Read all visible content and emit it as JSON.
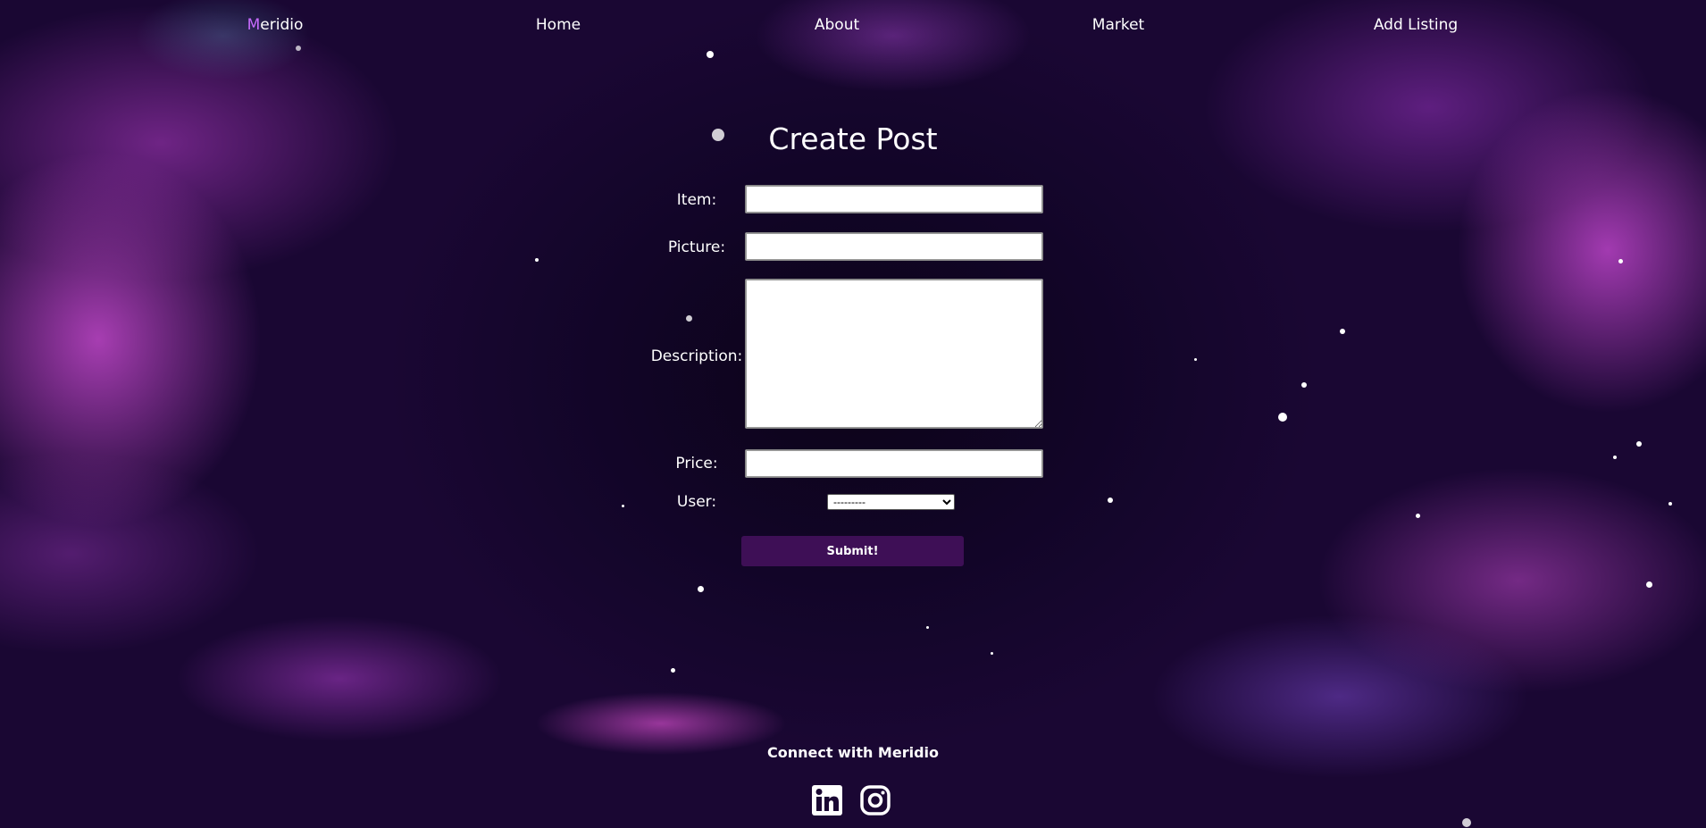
{
  "nav": {
    "brand_first": "M",
    "brand_rest": "eridio",
    "items": [
      {
        "label": "Home"
      },
      {
        "label": "About"
      },
      {
        "label": "Market"
      },
      {
        "label": "Add Listing"
      }
    ]
  },
  "form": {
    "title": "Create Post",
    "item_label": "Item:",
    "item_value": "",
    "picture_label": "Picture:",
    "picture_value": "",
    "description_label": "Description:",
    "description_value": "",
    "price_label": "Price:",
    "price_value": "",
    "user_label": "User:",
    "user_selected": "---------",
    "submit_label": "Submit!"
  },
  "footer": {
    "connect_text": "Connect with Meridio",
    "social": [
      {
        "icon": "linkedin-icon"
      },
      {
        "icon": "instagram-icon"
      }
    ]
  },
  "colors": {
    "brand_accent": "#c86bff",
    "submit_button": "#3e0f56",
    "background_dark": "#120528"
  }
}
